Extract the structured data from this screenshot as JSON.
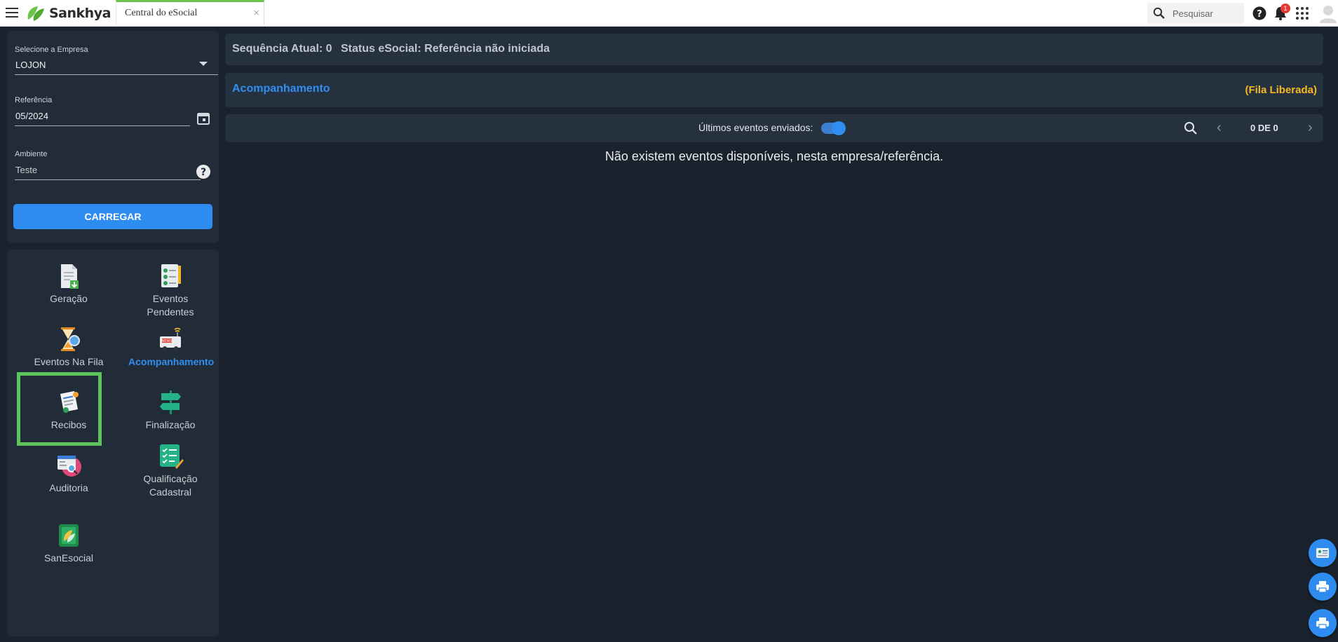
{
  "header": {
    "logo_text": "Sankhya",
    "tab_title": "Central do eSocial",
    "tab_close": "×",
    "search_placeholder": "Pesquisar",
    "notification_count": "1"
  },
  "form": {
    "empresa_label": "Selecione a Empresa",
    "empresa_value": "LOJON",
    "referencia_label": "Referência",
    "referencia_value": "05/2024",
    "ambiente_label": "Ambiente",
    "ambiente_value": "Teste",
    "load_button": "CARREGAR"
  },
  "menu": {
    "geracao": "Geração",
    "eventos_pendentes": "Eventos Pendentes",
    "eventos_na_fila": "Eventos Na Fila",
    "acompanhamento": "Acompanhamento",
    "recibos": "Recibos",
    "finalizacao": "Finalização",
    "auditoria": "Auditoria",
    "qualificacao_line1": "Qualificação",
    "qualificacao_line2": "Cadastral",
    "sanesocial": "SanEsocial"
  },
  "status": {
    "sequencia": "Sequência Atual: 0",
    "status_esocial": "Status eSocial: Referência não iniciada"
  },
  "acompanhamento": {
    "title": "Acompanhamento",
    "fila_status": "(Fila Liberada)"
  },
  "events": {
    "toggle_label": "Últimos eventos enviados:",
    "toggle_on": true,
    "pager_info": "0 DE 0",
    "empty_message": "Não existem eventos disponíveis, nesta empresa/referência."
  },
  "colors": {
    "accent": "#2e8cf0",
    "fila": "#f5b922",
    "highlight": "#5cc45a",
    "background": "#1a222d"
  }
}
